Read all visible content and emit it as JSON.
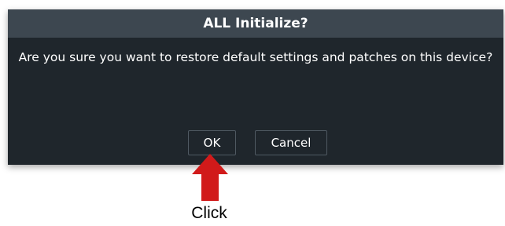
{
  "dialog": {
    "title": "ALL Initialize?",
    "message": "Are you sure you want to restore default settings and patches on this device?",
    "ok_label": "OK",
    "cancel_label": "Cancel"
  },
  "annotation": {
    "label": "Click",
    "arrow_color": "#d11a1a"
  },
  "colors": {
    "dialog_bg": "#1f262c",
    "titlebar_bg": "#3d4750"
  }
}
